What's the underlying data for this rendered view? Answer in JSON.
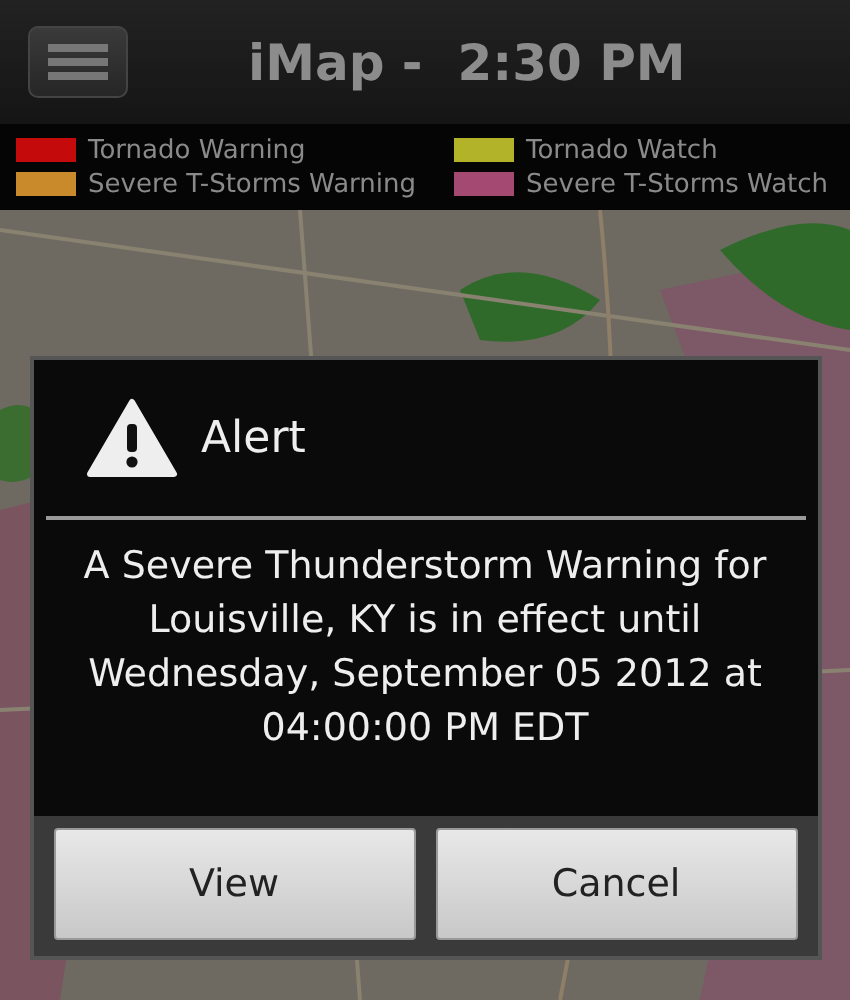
{
  "header": {
    "title": "iMap -  2:30 PM"
  },
  "legend": [
    {
      "label": "Tornado Warning",
      "color": "#c40a0a"
    },
    {
      "label": "Tornado Watch",
      "color": "#b3b32a"
    },
    {
      "label": "Severe T-Storms Warning",
      "color": "#c98a2c"
    },
    {
      "label": "Severe T-Storms Watch",
      "color": "#a44a72"
    }
  ],
  "dialog": {
    "title": "Alert",
    "message": "A Severe Thunderstorm Warning for Louisville, KY is in effect until Wednesday, September 05 2012 at 04:00:00 PM EDT",
    "buttons": [
      "View",
      "Cancel"
    ]
  }
}
